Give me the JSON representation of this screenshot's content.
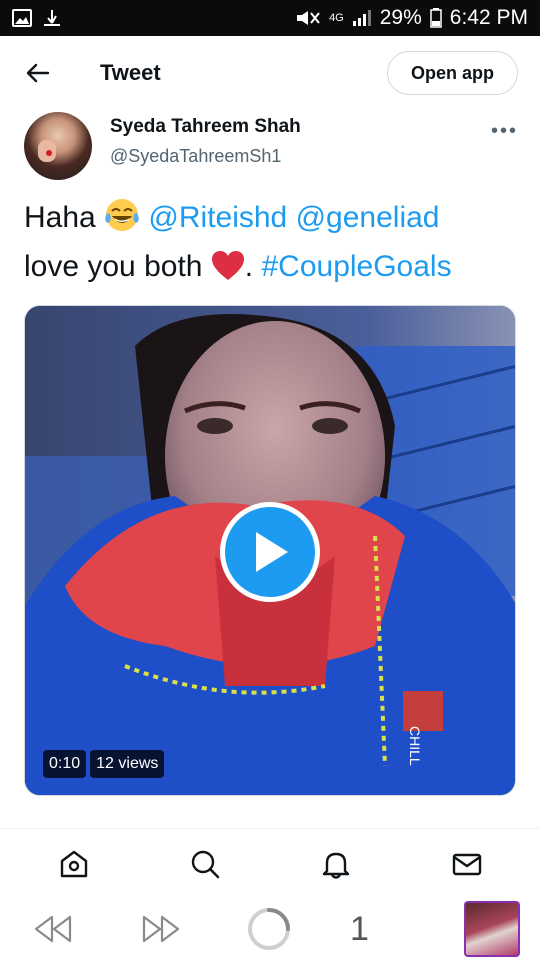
{
  "status_bar": {
    "signal_label": "4G",
    "battery": "29%",
    "time": "6:42 PM"
  },
  "header": {
    "title": "Tweet",
    "open_app_label": "Open app"
  },
  "author": {
    "display_name": "Syeda Tahreem Shah",
    "handle": "@SyedaTahreemSh1"
  },
  "tweet": {
    "text_1": "Haha ",
    "mention_1": "@Riteishd",
    "mention_2": "@geneliad",
    "text_2": "love you both ",
    "text_3": ". ",
    "hashtag": "#CoupleGoals"
  },
  "media": {
    "duration": "0:10",
    "views": "12 views"
  },
  "browser": {
    "tab_count": "1"
  },
  "colors": {
    "accent": "#1d9bf0",
    "secondary_text": "#536471",
    "border": "#cfd9de"
  }
}
